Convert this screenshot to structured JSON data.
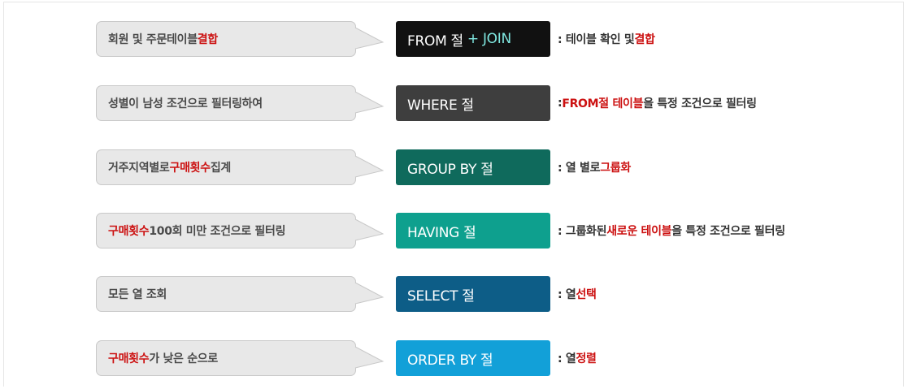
{
  "colors": {
    "highlight": "#cc1111",
    "bubble_bg": "#e8e8e8",
    "bubble_border": "#c9c9c9",
    "join_plus": "#7fe7e0"
  },
  "rows": [
    {
      "bubble": [
        "회원 및 주문테이블 ",
        "결합"
      ],
      "clause": "FROM 절",
      "clause_extra": "+ JOIN",
      "clause_color": "#111111",
      "desc": [
        ": 테이블 확인 및 ",
        "결합"
      ]
    },
    {
      "bubble": [
        "성별이 남성 조건으로 필터링하여",
        ""
      ],
      "clause": "WHERE 절",
      "clause_extra": "",
      "clause_color": "#3e3e3e",
      "desc": [
        ": ",
        "FROM절 테이블",
        "을 특정 조건으로 필터링"
      ]
    },
    {
      "bubble": [
        "거주지역별로 ",
        "구매횟수",
        " 집계"
      ],
      "clause": "GROUP BY 절",
      "clause_extra": "",
      "clause_color": "#0f6a5c",
      "desc": [
        ": 열 별로 ",
        "그룹화"
      ]
    },
    {
      "bubble": [
        "구매횟수",
        " 100회 미만 조건으로 필터링"
      ],
      "clause": "HAVING 절",
      "clause_extra": "",
      "clause_color": "#0ea08e",
      "desc": [
        ": 그룹화된 ",
        "새로운 테이블",
        "을 특정 조건으로 필터링"
      ]
    },
    {
      "bubble": [
        "모든 열 조회",
        ""
      ],
      "clause": "SELECT 절",
      "clause_extra": "",
      "clause_color": "#0d5d87",
      "desc": [
        ": 열 ",
        "선택"
      ]
    },
    {
      "bubble": [
        "구매횟수",
        "가 낮은 순으로"
      ],
      "clause": "ORDER BY 절",
      "clause_extra": "",
      "clause_color": "#12a0d8",
      "desc": [
        ": 열 ",
        "정렬"
      ]
    }
  ]
}
